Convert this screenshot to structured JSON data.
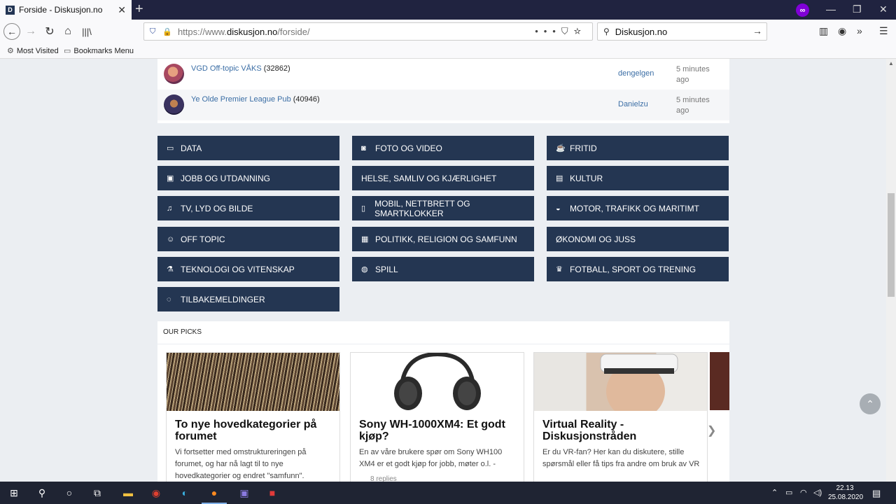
{
  "browser": {
    "tab_title": "Forside - Diskusjon.no",
    "tab_favicon": "D",
    "url_prefix": "https://www.",
    "url_domain": "diskusjon.no",
    "url_path": "/forside/",
    "search_text": "Diskusjon.no",
    "bookmarks": [
      "Most Visited",
      "Bookmarks Menu"
    ]
  },
  "topics": [
    {
      "title": "VGD Off-topic VÅKS",
      "count": "(32862)",
      "user": "dengelgen",
      "time": "5 minutes ago"
    },
    {
      "title": "Ye Olde Premier League Pub",
      "count": "(40946)",
      "user": "Danielzu",
      "time": "5 minutes ago"
    }
  ],
  "categories": [
    {
      "label": "DATA",
      "icon": "monitor-icon"
    },
    {
      "label": "FOTO OG VIDEO",
      "icon": "camera-icon"
    },
    {
      "label": "FRITID",
      "icon": "coffee-icon"
    },
    {
      "label": "JOBB OG UTDANNING",
      "icon": "briefcase-icon"
    },
    {
      "label": "HELSE, SAMLIV OG KJÆRLIGHET",
      "icon": ""
    },
    {
      "label": "KULTUR",
      "icon": "film-icon"
    },
    {
      "label": "TV, LYD OG BILDE",
      "icon": "music-icon"
    },
    {
      "label": "MOBIL, NETTBRETT OG SMARTKLOKKER",
      "icon": "mobile-icon"
    },
    {
      "label": "MOTOR, TRAFIKK OG MARITIMT",
      "icon": "dashboard-icon"
    },
    {
      "label": "OFF TOPIC",
      "icon": "smile-icon"
    },
    {
      "label": "POLITIKK, RELIGION OG SAMFUNN",
      "icon": "building-icon"
    },
    {
      "label": "ØKONOMI OG JUSS",
      "icon": ""
    },
    {
      "label": "TEKNOLOGI OG VITENSKAP",
      "icon": "flask-icon"
    },
    {
      "label": "SPILL",
      "icon": "gamepad-icon"
    },
    {
      "label": "FOTBALL, SPORT OG TRENING",
      "icon": "trophy-icon"
    },
    {
      "label": "TILBAKEMELDINGER",
      "icon": "comments-icon"
    }
  ],
  "picks": {
    "heading": "OUR PICKS",
    "cards": [
      {
        "title": "To nye hovedkategorier på forumet",
        "desc": "Vi fortsetter med omstruktureringen på forumet, og har nå lagt til to nye hovedkategorier og endret \"samfunn\".",
        "meta": ""
      },
      {
        "title": "Sony WH-1000XM4: Et godt kjøp?",
        "desc": "En av våre brukere spør om Sony WH100 XM4 er et godt kjøp for jobb, møter o.l. -",
        "meta": "8 replies"
      },
      {
        "title": "Virtual Reality - Diskusjonstråden",
        "desc": "Er du VR-fan? Her kan du diskutere, stille spørsmål eller få tips fra andre om bruk av VR",
        "meta": ""
      }
    ]
  },
  "taskbar": {
    "time": "22.13",
    "date": "25.08.2020"
  }
}
